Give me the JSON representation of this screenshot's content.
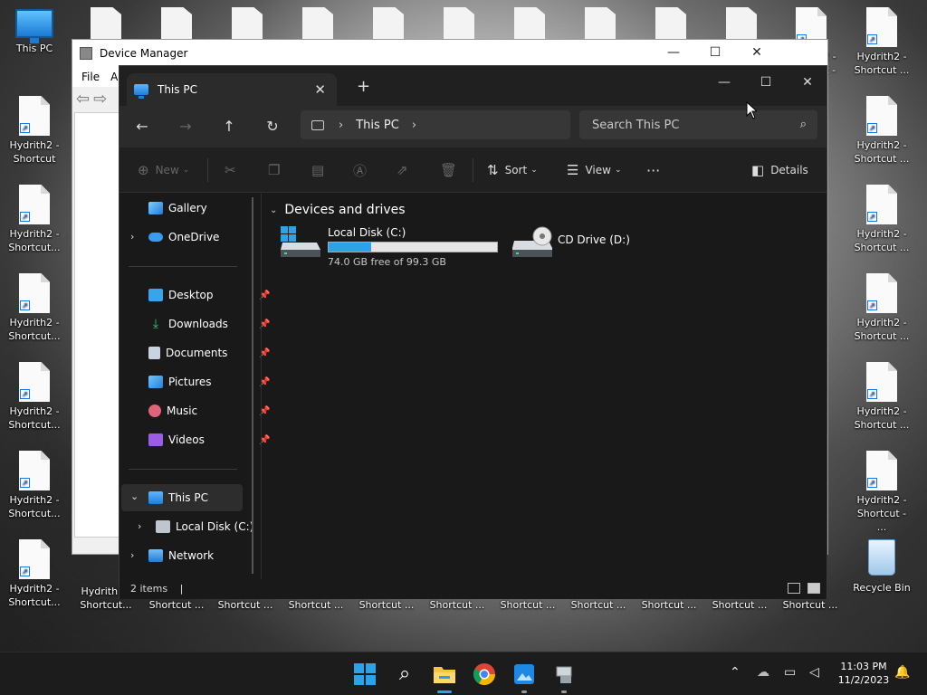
{
  "desktop": {
    "this_pc_label": "This PC",
    "recycle_bin_label": "Recycle Bin",
    "shortcut_labels_left": [
      "Hydrith2 - Shortcut",
      "Hydrith2 - Shortcut...",
      "Hydrith2 - Shortcut...",
      "Hydrith2 - Shortcut...",
      "Hydrith2 - Shortcut...",
      "Hydrith2 - Shortcut..."
    ],
    "shortcut_labels_right": [
      "Hydrith2 - Shortcut ...",
      "Hydrith2 - Shortcut ...",
      "Hydrith2 - Shortcut ...",
      "Hydrith2 - Shortcut ...",
      "Hydrith2 - Shortcut ...",
      "Hydrith2 - Shortcut - ..."
    ],
    "top_right_label": "Hydrith2 - Shortcut -",
    "bottom_labels": [
      "Hydrith2 - Shortcut...",
      "Shortcut...",
      "Shortcut ...",
      "Shortcut ...",
      "Shortcut ...",
      "Shortcut ...",
      "Shortcut ...",
      "Shortcut ...",
      "Shortcut ...",
      "Shortcut ...",
      "Shortcut ..."
    ]
  },
  "devmgr": {
    "title": "Device Manager",
    "menu_file": "File",
    "menu_a": "A"
  },
  "explorer": {
    "tab_title": "This PC",
    "address": "This PC",
    "search_placeholder": "Search This PC",
    "toolbar": {
      "new": "New",
      "sort": "Sort",
      "view": "View",
      "more": "···",
      "details": "Details"
    },
    "nav": {
      "gallery": "Gallery",
      "onedrive": "OneDrive",
      "desktop": "Desktop",
      "downloads": "Downloads",
      "documents": "Documents",
      "pictures": "Pictures",
      "music": "Music",
      "videos": "Videos",
      "this_pc": "This PC",
      "local_disk": "Local Disk (C:)",
      "network": "Network"
    },
    "group_title": "Devices and drives",
    "drives": [
      {
        "name": "Local Disk (C:)",
        "free_text": "74.0 GB free of 99.3 GB",
        "used_fraction": 0.255
      },
      {
        "name": "CD Drive (D:)"
      }
    ],
    "status_items": "2 items",
    "status_cursor": "|"
  },
  "taskbar": {
    "time": "11:03 PM",
    "date": "11/2/2023"
  },
  "colors": {
    "accent": "#2aa3e8",
    "explorer_bg": "#191919"
  }
}
